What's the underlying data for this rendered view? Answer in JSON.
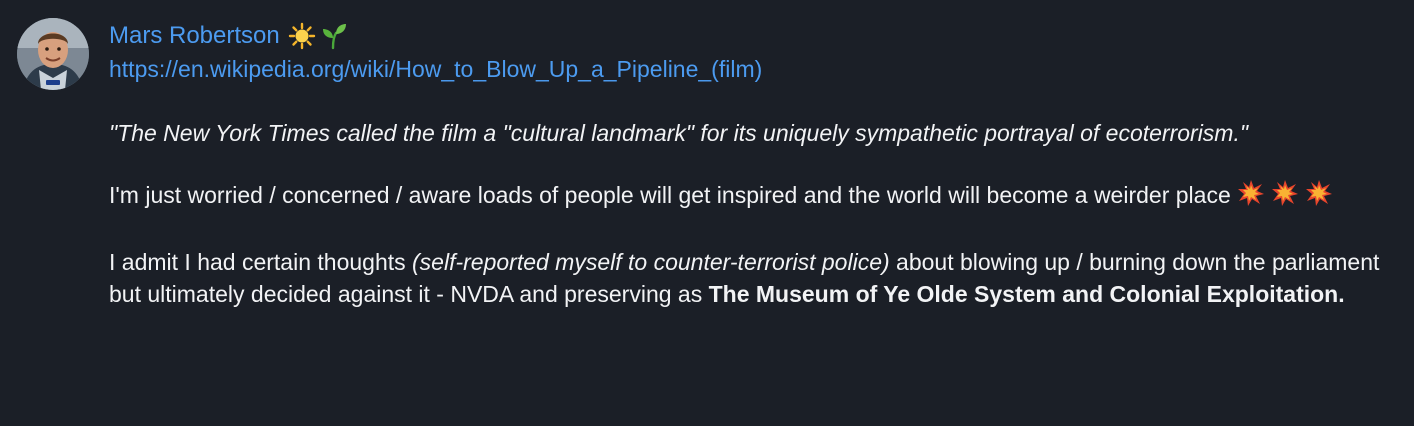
{
  "message": {
    "author": "Mars Robertson",
    "author_emoji": [
      "sun-icon",
      "seedling-icon"
    ],
    "link": "https://en.wikipedia.org/wiki/How_to_Blow_Up_a_Pipeline_(film)",
    "quote": "\"The New York Times called the film a \"cultural landmark\" for its uniquely sympathetic portrayal of ecoterrorism.\"",
    "paragraph2": {
      "text": "I'm just worried / concerned / aware loads of people will get inspired and the world will become a weirder place",
      "emoji": [
        "explosion-icon",
        "explosion-icon",
        "explosion-icon"
      ]
    },
    "paragraph3": {
      "part1": "I admit I had certain thoughts ",
      "italic": "(self-reported myself to counter-terrorist police)",
      "part2": " about blowing up / burning down the parliament but ultimately decided against it - NVDA and preserving as ",
      "bold": "The Museum of Ye Olde System and Colonial Exploitation."
    }
  },
  "colors": {
    "background": "#1b1f27",
    "link": "#4c9bf0",
    "text": "#f2f3f5"
  }
}
